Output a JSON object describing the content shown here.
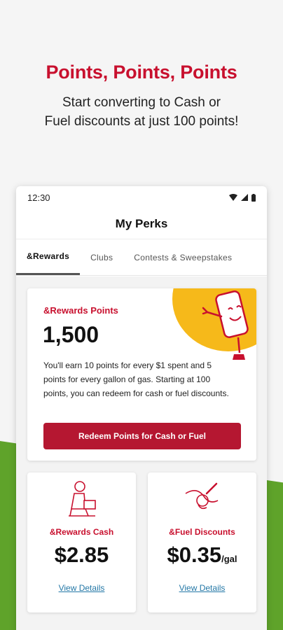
{
  "hero": {
    "title": "Points, Points, Points",
    "subtitle_line1": "Start converting to Cash or",
    "subtitle_line2": "Fuel discounts at just 100 points!"
  },
  "status_bar": {
    "time": "12:30"
  },
  "app": {
    "title": "My Perks"
  },
  "tabs": [
    {
      "label": "&Rewards",
      "active": true
    },
    {
      "label": "Clubs",
      "active": false
    },
    {
      "label": "Contests & Sweepstakes",
      "active": false
    }
  ],
  "points_card": {
    "label": "&Rewards Points",
    "value": "1,500",
    "description": "You'll earn 10 points for every $1 spent and 5 points for every gallon of gas. Starting at 100 points, you can redeem for cash or fuel discounts.",
    "button_label": "Redeem Points for Cash or Fuel"
  },
  "cash_card": {
    "label": "&Rewards Cash",
    "value": "$2.85",
    "link": "View Details"
  },
  "fuel_card": {
    "label": "&Fuel Discounts",
    "value": "$0.35",
    "unit": "/gal",
    "link": "View Details"
  },
  "colors": {
    "brand_red": "#c8102e",
    "button_red": "#b51731",
    "green": "#5fa32a",
    "yellow": "#f6b91a",
    "link_blue": "#2377a6"
  }
}
